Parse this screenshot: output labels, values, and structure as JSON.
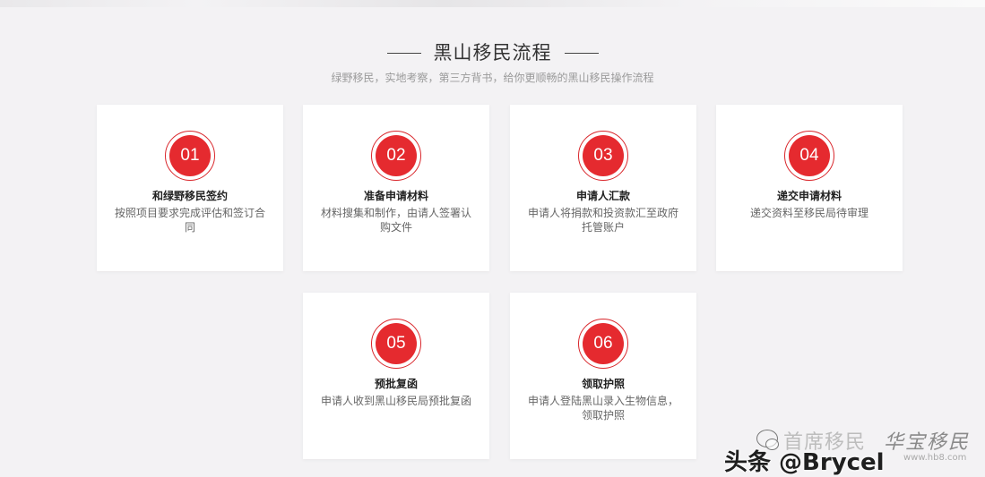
{
  "section": {
    "title": "黑山移民流程",
    "subtitle": "绿野移民，实地考察，第三方背书，给你更顺畅的黑山移民操作流程"
  },
  "steps": [
    {
      "number": "01",
      "title": "和绿野移民签约",
      "desc": "按照项目要求完成评估和签订合同"
    },
    {
      "number": "02",
      "title": "准备申请材料",
      "desc": "材料搜集和制作，由请人签署认购文件"
    },
    {
      "number": "03",
      "title": "申请人汇款",
      "desc": "申请人将捐款和投资款汇至政府托管账户"
    },
    {
      "number": "04",
      "title": "递交申请材料",
      "desc": "递交资料至移民局待审理"
    },
    {
      "number": "05",
      "title": "预批复函",
      "desc": "申请人收到黑山移民局预批复函"
    },
    {
      "number": "06",
      "title": "领取护照",
      "desc": "申请人登陆黑山录入生物信息，领取护照"
    }
  ],
  "watermark": {
    "account": "首席移民",
    "toutiao": "头条 @Brycel",
    "logo_text": "华宝移民",
    "logo_url": "www.hb8.com"
  },
  "colors": {
    "accent": "#e52a2f",
    "background": "#f3f2f4",
    "card": "#ffffff"
  }
}
